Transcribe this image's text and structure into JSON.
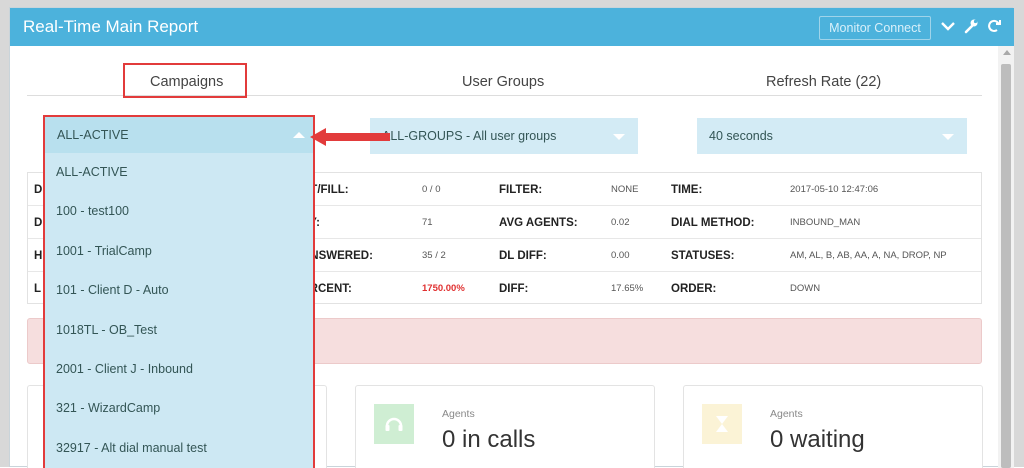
{
  "header": {
    "title": "Real-Time Main Report",
    "monitor_label": "Monitor Connect",
    "icons": [
      "chevron-down-icon",
      "wrench-icon",
      "refresh-icon"
    ]
  },
  "tabs": {
    "campaigns": "Campaigns",
    "user_groups": "User Groups",
    "refresh_rate": "Refresh Rate (22)"
  },
  "selects": {
    "campaign_selected": "ALL-ACTIVE",
    "group_selected": "ALL-GROUPS - All user groups",
    "refresh_selected": "40 seconds"
  },
  "campaign_options": [
    "ALL-ACTIVE",
    "100 - test100",
    "1001 - TrialCamp",
    "101 - Client D - Auto",
    "1018TL - OB_Test",
    "2001 - Client J - Inbound",
    "321 - WizardCamp",
    "32917 - Alt dial manual test"
  ],
  "stats": {
    "rows": [
      {
        "c1": "D",
        "l2": "RT/FILL:",
        "v2": "0 / 0",
        "l3": "FILTER:",
        "v3": "NONE",
        "l4": "TIME:",
        "v4": "2017-05-10 12:47:06"
      },
      {
        "c1": "D",
        "l2": "AY:",
        "v2": "71",
        "l3": "AVG AGENTS:",
        "v3": "0.02",
        "l4": "DIAL METHOD:",
        "v4": "INBOUND_MAN"
      },
      {
        "c1": "H",
        "l2": "ANSWERED:",
        "v2": "35 / 2",
        "l3": "DL DIFF:",
        "v3": "0.00",
        "l4": "STATUSES:",
        "v4": "AM, AL, B, AB, AA, A, NA, DROP, NP"
      },
      {
        "c1": "L",
        "l2": "ERCENT:",
        "v2": "1750.00%",
        "l3": "DIFF:",
        "v3": "17.65%",
        "l4": "ORDER:",
        "v4": "DOWN"
      }
    ]
  },
  "cards": {
    "calls": {
      "sub": "Agents",
      "value": "0 in calls",
      "color": "#cfeed3",
      "icon": "headset-icon"
    },
    "waiting": {
      "sub": "Agents",
      "value": "0 waiting",
      "color": "#fbf3d6",
      "icon": "hourglass-icon"
    }
  },
  "colors": {
    "header": "#4cb2dc",
    "highlight": "#e23b3b",
    "select": "#d3ebf5"
  }
}
